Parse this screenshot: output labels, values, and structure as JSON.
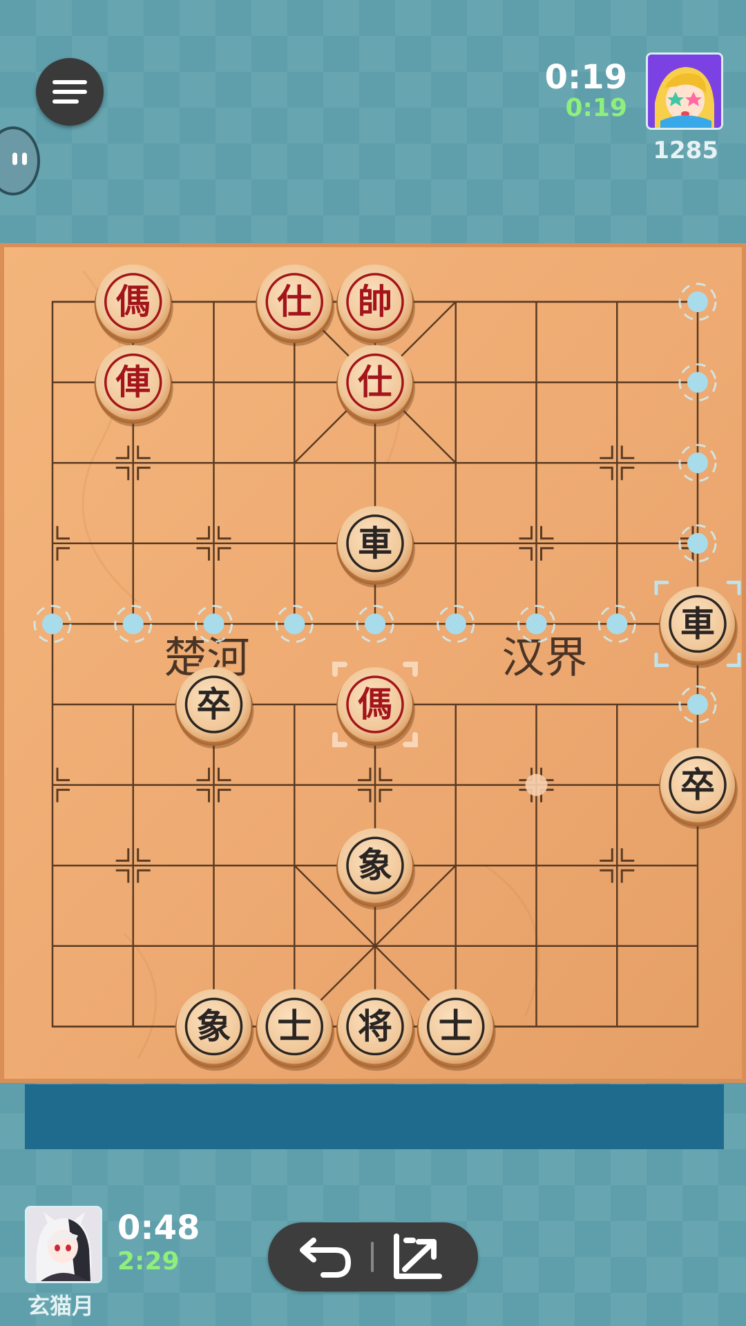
{
  "top_bar": {
    "menu_icon": "hamburger-menu-icon",
    "chat_icon": "chat-bubble-icon",
    "opponent": {
      "turn_time": "0:19",
      "total_time": "0:19",
      "rating": "1285",
      "avatar": "anime-avatar-blonde-star"
    }
  },
  "board": {
    "river_left": "楚河",
    "river_right": "汉界",
    "red_pieces": [
      {
        "char": "傌",
        "file": 1,
        "rank": 0
      },
      {
        "char": "仕",
        "file": 3,
        "rank": 0
      },
      {
        "char": "帥",
        "file": 4,
        "rank": 0
      },
      {
        "char": "俥",
        "file": 1,
        "rank": 1
      },
      {
        "char": "仕",
        "file": 4,
        "rank": 1
      },
      {
        "char": "傌",
        "file": 4,
        "rank": 5
      }
    ],
    "black_pieces": [
      {
        "char": "車",
        "file": 4,
        "rank": 3
      },
      {
        "char": "車",
        "file": 8,
        "rank": 4
      },
      {
        "char": "卒",
        "file": 2,
        "rank": 5
      },
      {
        "char": "卒",
        "file": 8,
        "rank": 6
      },
      {
        "char": "象",
        "file": 4,
        "rank": 7
      },
      {
        "char": "象",
        "file": 2,
        "rank": 9
      },
      {
        "char": "士",
        "file": 3,
        "rank": 9
      },
      {
        "char": "将",
        "file": 4,
        "rank": 9
      },
      {
        "char": "士",
        "file": 5,
        "rank": 9
      }
    ],
    "selected_piece": {
      "file": 8,
      "rank": 4
    },
    "last_move_from": {
      "file": 6,
      "rank": 6
    },
    "last_move_to": {
      "file": 4,
      "rank": 5
    },
    "legal_move_dots": [
      {
        "file": 8,
        "rank": 0
      },
      {
        "file": 8,
        "rank": 1
      },
      {
        "file": 8,
        "rank": 2
      },
      {
        "file": 8,
        "rank": 3
      },
      {
        "file": 0,
        "rank": 4
      },
      {
        "file": 1,
        "rank": 4
      },
      {
        "file": 2,
        "rank": 4
      },
      {
        "file": 3,
        "rank": 4
      },
      {
        "file": 4,
        "rank": 4
      },
      {
        "file": 5,
        "rank": 4
      },
      {
        "file": 6,
        "rank": 4
      },
      {
        "file": 7,
        "rank": 4
      },
      {
        "file": 8,
        "rank": 5
      }
    ]
  },
  "bottom_bar": {
    "player": {
      "name": "玄猫月",
      "turn_time": "0:48",
      "total_time": "2:29",
      "avatar": "anime-avatar-white-hair-cat"
    },
    "controls": {
      "undo_icon": "undo-arrow-icon",
      "draw_icon": "offer-draw-icon"
    }
  },
  "colors": {
    "background": "#5e9fab",
    "board_wood": "#eeab73",
    "red_piece_text": "#a3141b",
    "black_piece_text": "#2a2522",
    "timer_total_green": "#8ef07a",
    "move_dot": "#a9dcea"
  }
}
